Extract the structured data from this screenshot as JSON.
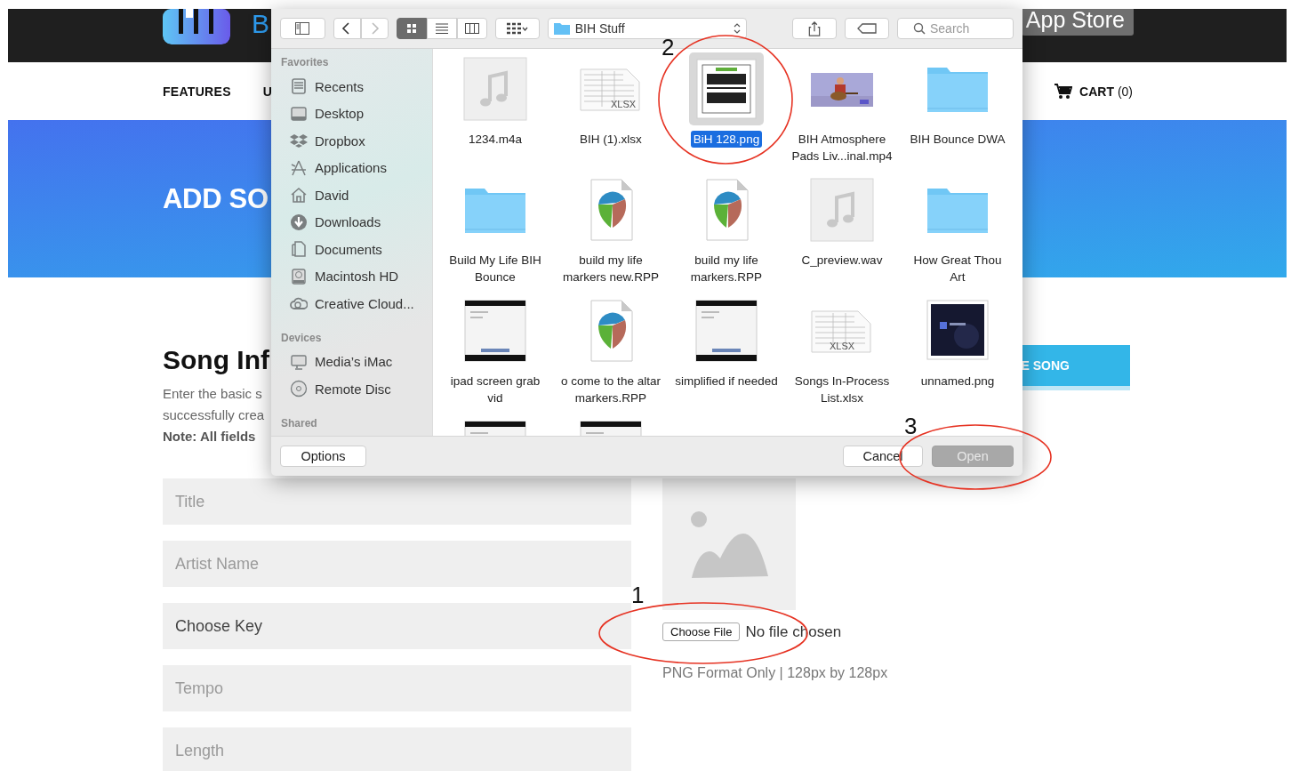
{
  "site_header": {
    "logo_text": "B",
    "badge": "App Store"
  },
  "nav": {
    "items": [
      {
        "label": "FEATURES"
      },
      {
        "label": "U"
      }
    ],
    "cart": "**CART** (0)"
  },
  "banner": {
    "title": "ADD SO"
  },
  "song_info": {
    "heading": "Song Inf",
    "lines": [
      "Enter the basic s",
      "successfully crea"
    ],
    "note": "Note: All fields",
    "button": "E SONG"
  },
  "form": {
    "fields": [
      {
        "kind": "input",
        "placeholder": "Title"
      },
      {
        "kind": "input",
        "placeholder": "Artist Name"
      },
      {
        "kind": "select",
        "value": "Choose Key"
      },
      {
        "kind": "input",
        "placeholder": "Tempo"
      },
      {
        "kind": "input",
        "placeholder": "Length"
      }
    ],
    "upload": {
      "button": "Choose File",
      "status": "No file chosen",
      "hint": "PNG Format Only | 128px by 128px"
    }
  },
  "dialog": {
    "toolbar": {
      "nav_buttons": [
        {
          "kind": "back",
          "disabled": false
        },
        {
          "kind": "forward",
          "disabled": true
        }
      ],
      "views": [
        {
          "kind": "icons",
          "selected": true
        },
        {
          "kind": "list",
          "selected": false
        },
        {
          "kind": "columns",
          "selected": false
        }
      ],
      "location": "BIH Stuff",
      "search": {
        "placeholder": "Search"
      }
    },
    "sidebar": {
      "sections": [
        {
          "title": "Favorites",
          "items": [
            {
              "label": "Recents",
              "kind": "recents"
            },
            {
              "label": "Desktop",
              "kind": "desktop"
            },
            {
              "label": "Dropbox",
              "kind": "boxes"
            },
            {
              "label": "Applications",
              "kind": "apps"
            },
            {
              "label": "David",
              "kind": "home"
            },
            {
              "label": "Downloads",
              "kind": "downloads"
            },
            {
              "label": "Documents",
              "kind": "documents"
            },
            {
              "label": "Macintosh HD",
              "kind": "disk"
            },
            {
              "label": "Creative Cloud...",
              "kind": "cloud"
            }
          ]
        },
        {
          "title": "Devices",
          "items": [
            {
              "label": "Media’s iMac",
              "kind": "computer"
            },
            {
              "label": "Remote Disc",
              "kind": "disc"
            }
          ]
        },
        {
          "title": "Shared"
        }
      ]
    },
    "files": [
      {
        "name": "1234.m4a",
        "kind": "audio",
        "selected": false
      },
      {
        "name": "BIH (1).xlsx",
        "kind": "sheet",
        "badge": "XLSX",
        "selected": false
      },
      {
        "name": "BiH 128.png",
        "kind": "logo_image",
        "selected": true
      },
      {
        "name": "BIH Atmosphere Pads Liv...inal.mp4",
        "kind": "video",
        "selected": false
      },
      {
        "name": "BIH Bounce DWA",
        "kind": "folder",
        "selected": false
      },
      {
        "name": "Build My Life BIH Bounce",
        "kind": "folder",
        "selected": false
      },
      {
        "name": "build my life markers new.RPP",
        "kind": "project",
        "selected": false
      },
      {
        "name": "build my life markers.RPP",
        "kind": "project",
        "selected": false
      },
      {
        "name": "C_preview.wav",
        "kind": "audio",
        "selected": false
      },
      {
        "name": "How Great Thou Art",
        "kind": "folder",
        "selected": false
      },
      {
        "name": "ipad screen grab vid",
        "kind": "screen",
        "selected": false
      },
      {
        "name": "o come to the altar markers.RPP",
        "kind": "project",
        "selected": false
      },
      {
        "name": "simplified if needed",
        "kind": "screen",
        "selected": false
      },
      {
        "name": "Songs In-Process List.xlsx",
        "kind": "sheet",
        "badge": "XLSX",
        "selected": false
      },
      {
        "name": "unnamed.png",
        "kind": "dark_image",
        "selected": false
      },
      {
        "kind": "screen",
        "selected": false
      },
      {
        "kind": "screen",
        "selected": false
      }
    ],
    "options_button": "Options",
    "buttons": [
      {
        "label": "Cancel",
        "disabled": false
      },
      {
        "label": "Open",
        "disabled": true
      }
    ]
  },
  "annotations": [
    {
      "label": "2"
    },
    {
      "label": "3"
    },
    {
      "label": "1"
    }
  ]
}
